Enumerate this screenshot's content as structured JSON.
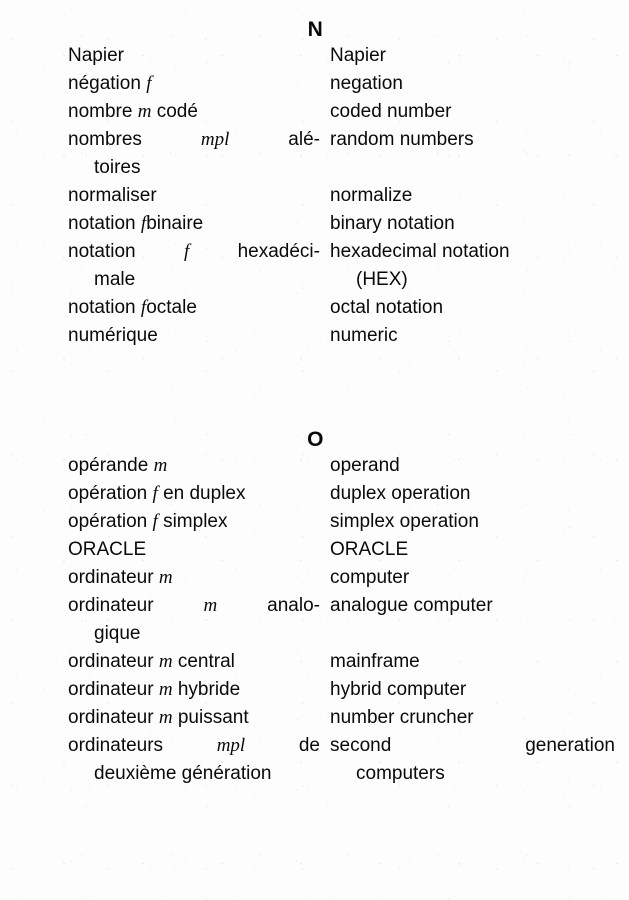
{
  "page": {
    "type": "bilingual-dictionary-page",
    "languages": [
      "French",
      "English"
    ]
  },
  "sections": [
    {
      "heading": "N",
      "entries": [
        {
          "fr_lines": [
            {
              "text": "Napier"
            }
          ],
          "en_lines": [
            {
              "text": "Napier"
            }
          ]
        },
        {
          "fr_lines": [
            {
              "text": "négation ",
              "gram": "f"
            }
          ],
          "en_lines": [
            {
              "text": "negation"
            }
          ]
        },
        {
          "fr_lines": [
            {
              "text": "nombre ",
              "gram": "m",
              "after": " codé"
            }
          ],
          "en_lines": [
            {
              "text": "coded number"
            }
          ]
        },
        {
          "fr_lines": [
            {
              "justified": true,
              "parts": [
                "nombres",
                "mpl",
                "alé-"
              ],
              "gram_index": 1
            },
            {
              "text": "toires",
              "runover": true
            }
          ],
          "en_lines": [
            {
              "text": "random numbers"
            },
            {
              "text": "",
              "blank": true
            }
          ]
        },
        {
          "fr_lines": [
            {
              "text": "normaliser"
            }
          ],
          "en_lines": [
            {
              "text": "normalize"
            }
          ]
        },
        {
          "fr_lines": [
            {
              "text": "notation ",
              "gram": "f",
              "after": "binaire"
            }
          ],
          "en_lines": [
            {
              "text": "binary notation"
            }
          ]
        },
        {
          "fr_lines": [
            {
              "justified": true,
              "parts": [
                "notation",
                "f",
                "hexadéci-"
              ],
              "gram_index": 1
            },
            {
              "text": "male",
              "runover": true
            }
          ],
          "en_lines": [
            {
              "text": "hexadecimal notation"
            },
            {
              "text": "(HEX)",
              "runover": true
            }
          ]
        },
        {
          "fr_lines": [
            {
              "text": "notation ",
              "gram": "f",
              "after": "octale"
            }
          ],
          "en_lines": [
            {
              "text": "octal notation"
            }
          ]
        },
        {
          "fr_lines": [
            {
              "text": "numérique"
            }
          ],
          "en_lines": [
            {
              "text": "numeric"
            }
          ]
        }
      ]
    },
    {
      "heading": "O",
      "entries": [
        {
          "fr_lines": [
            {
              "text": "opérande ",
              "gram": "m"
            }
          ],
          "en_lines": [
            {
              "text": "operand"
            }
          ]
        },
        {
          "fr_lines": [
            {
              "text": "opération ",
              "gram": "f",
              "after": " en duplex"
            }
          ],
          "en_lines": [
            {
              "text": "duplex operation"
            }
          ]
        },
        {
          "fr_lines": [
            {
              "text": "opération ",
              "gram": "f",
              "after": " simplex"
            }
          ],
          "en_lines": [
            {
              "text": "simplex operation"
            }
          ]
        },
        {
          "fr_lines": [
            {
              "text": "ORACLE"
            }
          ],
          "en_lines": [
            {
              "text": "ORACLE"
            }
          ]
        },
        {
          "fr_lines": [
            {
              "text": "ordinateur ",
              "gram": "m"
            }
          ],
          "en_lines": [
            {
              "text": "computer"
            }
          ]
        },
        {
          "fr_lines": [
            {
              "justified": true,
              "parts": [
                "ordinateur",
                "m",
                "analo-"
              ],
              "gram_index": 1
            },
            {
              "text": "gique",
              "runover": true
            }
          ],
          "en_lines": [
            {
              "text": "analogue computer"
            },
            {
              "text": "",
              "blank": true
            }
          ]
        },
        {
          "fr_lines": [
            {
              "text": "ordinateur ",
              "gram": "m",
              "after": " central"
            }
          ],
          "en_lines": [
            {
              "text": "mainframe"
            }
          ]
        },
        {
          "fr_lines": [
            {
              "text": "ordinateur ",
              "gram": "m",
              "after": " hybride"
            }
          ],
          "en_lines": [
            {
              "text": "hybrid computer"
            }
          ]
        },
        {
          "fr_lines": [
            {
              "text": "ordinateur ",
              "gram": "m",
              "after": " puissant"
            }
          ],
          "en_lines": [
            {
              "text": "number cruncher"
            }
          ]
        },
        {
          "fr_lines": [
            {
              "justified": true,
              "parts": [
                "ordinateurs",
                "mpl",
                "de"
              ],
              "gram_index": 1
            },
            {
              "text": "deuxième génération",
              "runover": true
            }
          ],
          "en_lines": [
            {
              "justified": true,
              "parts": [
                "second",
                "generation"
              ]
            },
            {
              "text": "computers",
              "runover": true
            }
          ]
        }
      ]
    }
  ]
}
